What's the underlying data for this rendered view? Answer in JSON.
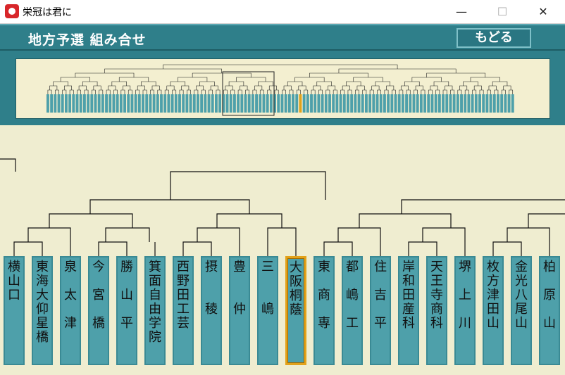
{
  "window": {
    "title": "栄冠は君に",
    "minimize": "—",
    "maximize": "☐",
    "close": "✕"
  },
  "header": {
    "title": "地方予選  組み合せ",
    "back_label": "もどる"
  },
  "schools": [
    {
      "name": "横\n山\n口"
    },
    {
      "name": "東\n海\n大\n仰\n星\n橋"
    },
    {
      "name": "泉\n\n太\n\n津"
    },
    {
      "name": "今\n\n宮\n\n橋"
    },
    {
      "name": "勝\n\n山\n\n平"
    },
    {
      "name": "箕\n面\n自\n由\n学\n院"
    },
    {
      "name": "西\n野\n田\n工\n芸"
    },
    {
      "name": "摂\n\n\n稜"
    },
    {
      "name": "豊\n\n\n仲"
    },
    {
      "name": "三\n\n\n嶋"
    },
    {
      "name": "大\n阪\n桐\n蔭",
      "selected": true
    },
    {
      "name": "東\n\n商\n\n専"
    },
    {
      "name": "都\n\n嶋\n\n工"
    },
    {
      "name": "住\n\n吉\n\n平"
    },
    {
      "name": "岸\n和\n田\n産\n科"
    },
    {
      "name": "天\n王\n寺\n商\n科"
    },
    {
      "name": "堺\n\n上\n\n川"
    },
    {
      "name": "枚\n方\n津\n田\n山"
    },
    {
      "name": "金\n光\n八\n尾\n山"
    },
    {
      "name": "柏\n\n原\n\n山"
    }
  ],
  "colors": {
    "teal": "#2f7f8a",
    "slot": "#4ea0aa",
    "selected_border": "#e2a21a",
    "background": "#efedd0"
  }
}
